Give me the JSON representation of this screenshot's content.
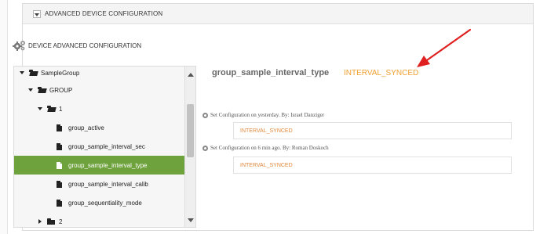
{
  "panel": {
    "title": "ADVANCED DEVICE CONFIGURATION"
  },
  "section": {
    "title": "DEVICE ADVANCED CONFIGURATION"
  },
  "tree": {
    "items": [
      {
        "label": "SampleGroup",
        "level": 0,
        "kind": "folder-open",
        "expanded": true
      },
      {
        "label": "GROUP",
        "level": 1,
        "kind": "folder-open",
        "expanded": true
      },
      {
        "label": "1",
        "level": 2,
        "kind": "folder-open",
        "expanded": true
      },
      {
        "label": "group_active",
        "level": 3,
        "kind": "file"
      },
      {
        "label": "group_sample_interval_sec",
        "level": 3,
        "kind": "file"
      },
      {
        "label": "group_sample_interval_type",
        "level": 3,
        "kind": "file",
        "selected": true
      },
      {
        "label": "group_sample_interval_calib",
        "level": 3,
        "kind": "file"
      },
      {
        "label": "group_sequentiality_mode",
        "level": 3,
        "kind": "file"
      },
      {
        "label": "2",
        "level": 2,
        "kind": "folder",
        "expanded": false
      }
    ]
  },
  "detail": {
    "name": "group_sample_interval_type",
    "value": "INTERVAL_SYNCED",
    "history": [
      {
        "meta": "Set Configuration on yesterday. By: Israel Danziger",
        "value": "INTERVAL_SYNCED"
      },
      {
        "meta": "Set Configuration on 6 min ago. By: Roman Doskoch",
        "value": "INTERVAL_SYNCED"
      }
    ]
  },
  "colors": {
    "selected": "#6ea23c",
    "value_accent": "#f0a030",
    "arrow": "#e02020"
  }
}
